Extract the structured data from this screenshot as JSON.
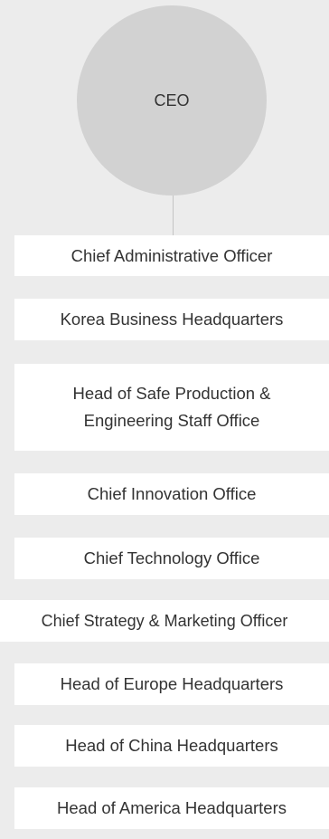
{
  "org_chart": {
    "root": {
      "label": "CEO"
    },
    "units": [
      {
        "label": "Chief Administrative Officer"
      },
      {
        "label": "Korea Business Headquarters"
      },
      {
        "label": "Head of Safe Production & Engineering Staff Office"
      },
      {
        "label": "Chief Innovation Office"
      },
      {
        "label": "Chief Technology Office"
      },
      {
        "label": "Chief Strategy & Marketing Officer"
      },
      {
        "label": "Head of Europe Headquarters"
      },
      {
        "label": "Head of China Headquarters"
      },
      {
        "label": "Head of America Headquarters"
      }
    ]
  }
}
